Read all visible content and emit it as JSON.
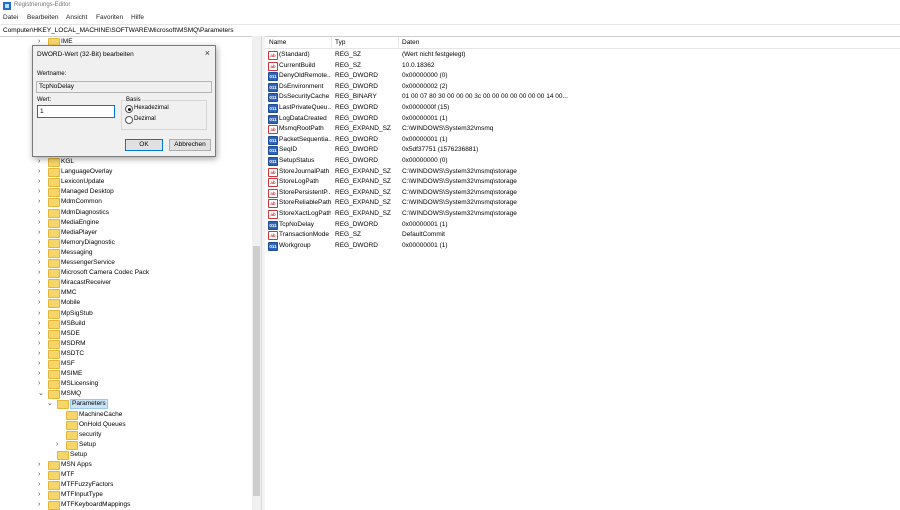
{
  "window": {
    "title": "Registrierungs-Editor"
  },
  "menu": [
    "Datei",
    "Bearbeiten",
    "Ansicht",
    "Favoriten",
    "Hilfe"
  ],
  "address": "Computer\\HKEY_LOCAL_MACHINE\\SOFTWARE\\Microsoft\\MSMQ\\Parameters",
  "tree": {
    "top_item": "IME",
    "items": [
      "KGL",
      "LanguageOverlay",
      "LexiconUpdate",
      "Managed Desktop",
      "MdmCommon",
      "MdmDiagnostics",
      "MediaEngine",
      "MediaPlayer",
      "MemoryDiagnostic",
      "Messaging",
      "MessengerService",
      "Microsoft Camera Codec Pack",
      "MiracastReceiver",
      "MMC",
      "Mobile",
      "MpSigStub",
      "MSBuild",
      "MSDE",
      "MSDRM",
      "MSDTC",
      "MSF",
      "MSIME",
      "MSLicensing",
      "MSMQ"
    ],
    "msmq_children": [
      "Parameters",
      "MachineCache",
      "OnHold Queues",
      "security",
      "Setup"
    ],
    "msmq_setup": "Setup",
    "after_items": [
      "MSN Apps",
      "MTF",
      "MTFFuzzyFactors",
      "MTFInputType",
      "MTFKeyboardMappings"
    ]
  },
  "list": {
    "headers": {
      "name": "Name",
      "type": "Typ",
      "data": "Daten"
    },
    "rows": [
      {
        "icon": "ab",
        "name": "(Standard)",
        "type": "REG_SZ",
        "data": "(Wert nicht festgelegt)"
      },
      {
        "icon": "ab",
        "name": "CurrentBuild",
        "type": "REG_SZ",
        "data": "10.0.18362"
      },
      {
        "icon": "011",
        "name": "DenyOldRemote...",
        "type": "REG_DWORD",
        "data": "0x00000000 (0)"
      },
      {
        "icon": "011",
        "name": "DsEnvironment",
        "type": "REG_DWORD",
        "data": "0x00000002 (2)"
      },
      {
        "icon": "011",
        "name": "DsSecurityCache",
        "type": "REG_BINARY",
        "data": "01 00 07 80 30 00 00 00 3c 00 00 00 00 00 00 00 14 00..."
      },
      {
        "icon": "011",
        "name": "LastPrivateQueu...",
        "type": "REG_DWORD",
        "data": "0x0000000f (15)"
      },
      {
        "icon": "011",
        "name": "LogDataCreated",
        "type": "REG_DWORD",
        "data": "0x00000001 (1)"
      },
      {
        "icon": "ab",
        "name": "MsmqRootPath",
        "type": "REG_EXPAND_SZ",
        "data": "C:\\WINDOWS\\System32\\msmq"
      },
      {
        "icon": "011",
        "name": "PacketSequentia...",
        "type": "REG_DWORD",
        "data": "0x00000001 (1)"
      },
      {
        "icon": "011",
        "name": "SeqID",
        "type": "REG_DWORD",
        "data": "0x5df37751 (1576236881)"
      },
      {
        "icon": "011",
        "name": "SetupStatus",
        "type": "REG_DWORD",
        "data": "0x00000000 (0)"
      },
      {
        "icon": "ab",
        "name": "StoreJournalPath",
        "type": "REG_EXPAND_SZ",
        "data": "C:\\WINDOWS\\System32\\msmq\\storage"
      },
      {
        "icon": "ab",
        "name": "StoreLogPath",
        "type": "REG_EXPAND_SZ",
        "data": "C:\\WINDOWS\\System32\\msmq\\storage"
      },
      {
        "icon": "ab",
        "name": "StorePersistentP...",
        "type": "REG_EXPAND_SZ",
        "data": "C:\\WINDOWS\\System32\\msmq\\storage"
      },
      {
        "icon": "ab",
        "name": "StoreReliablePath",
        "type": "REG_EXPAND_SZ",
        "data": "C:\\WINDOWS\\System32\\msmq\\storage"
      },
      {
        "icon": "ab",
        "name": "StoreXactLogPath",
        "type": "REG_EXPAND_SZ",
        "data": "C:\\WINDOWS\\System32\\msmq\\storage"
      },
      {
        "icon": "011",
        "name": "TcpNoDelay",
        "type": "REG_DWORD",
        "data": "0x00000001 (1)"
      },
      {
        "icon": "ab",
        "name": "TransactionMode",
        "type": "REG_SZ",
        "data": "DefaultCommit"
      },
      {
        "icon": "011",
        "name": "Workgroup",
        "type": "REG_DWORD",
        "data": "0x00000001 (1)"
      }
    ]
  },
  "dialog": {
    "title": "DWORD-Wert (32-Bit) bearbeiten",
    "close": "×",
    "name_label": "Wertname:",
    "name_value": "TcpNoDelay",
    "value_label": "Wert:",
    "value_value": "1",
    "base_label": "Basis",
    "radio_hex": "Hexadezimal",
    "radio_dec": "Dezimal",
    "selected_base": "Hexadezimal",
    "ok": "OK",
    "cancel": "Abbrechen"
  },
  "colors": {
    "accent": "#0078d7",
    "folder": "#f6d66b",
    "selection": "#cce4f7"
  }
}
